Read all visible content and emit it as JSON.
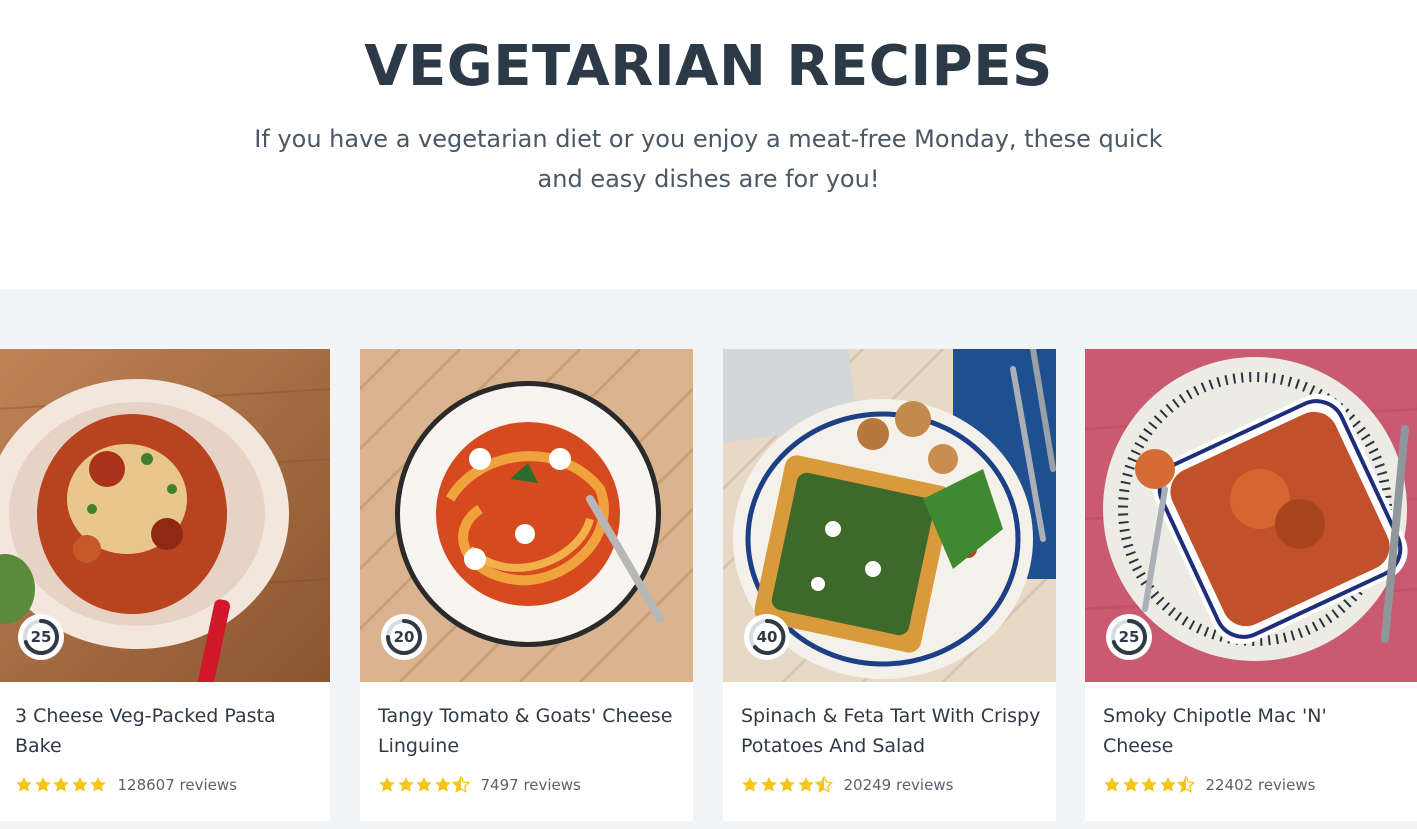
{
  "header": {
    "title": "VEGETARIAN RECIPES",
    "subtitle_line1": "If you have a vegetarian diet or you enjoy a meat-free Monday, these quick",
    "subtitle_line2": "and easy dishes are for you!"
  },
  "colors": {
    "star": "#f5c518",
    "background_band": "#f2f5f8",
    "text": "#2f3a45"
  },
  "recipes": [
    {
      "title": "3 Cheese Veg-Packed Pasta Bake",
      "time": "25",
      "rating": 5,
      "reviews": "128607 reviews",
      "image": "pasta-bake-image"
    },
    {
      "title": "Tangy Tomato & Goats' Cheese Linguine",
      "time": "20",
      "rating": 4.5,
      "reviews": "7497 reviews",
      "image": "linguine-image"
    },
    {
      "title": "Spinach & Feta Tart With Crispy Potatoes And Salad",
      "time": "40",
      "rating": 4.5,
      "reviews": "20249 reviews",
      "image": "tart-image"
    },
    {
      "title": "Smoky Chipotle Mac 'N' Cheese",
      "time": "25",
      "rating": 4.5,
      "reviews": "22402 reviews",
      "image": "mac-cheese-image"
    }
  ]
}
